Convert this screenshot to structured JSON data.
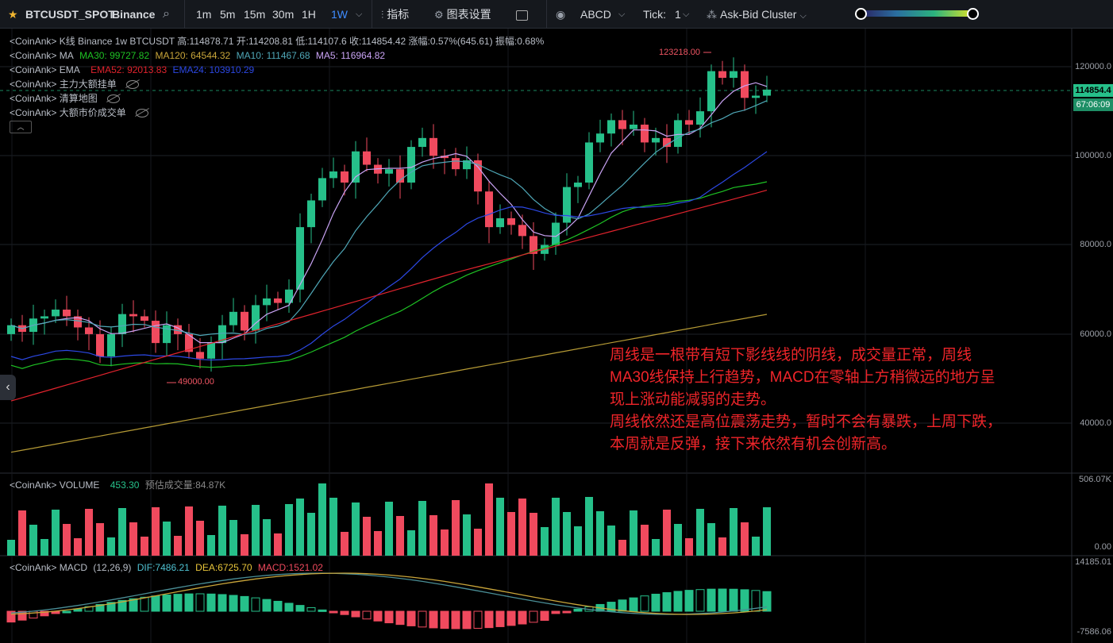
{
  "toolbar": {
    "symbol": "BTCUSDT_SPOT",
    "exchange": "Binance",
    "intervals": [
      "1m",
      "5m",
      "15m",
      "30m",
      "1H",
      "1W"
    ],
    "active_interval": "1W",
    "indicators_label": "指标",
    "chart_settings_label": "图表设置",
    "abcd_label": "ABCD",
    "tick_label": "Tick:",
    "tick_value": "1",
    "cluster_label": "Ask-Bid Cluster"
  },
  "legend": {
    "kline": "<CoinAnk> K线  Binance 1w BTCUSDT 高:114878.71 开:114208.81 低:114107.6 收:114854.42 涨幅:0.57%(645.61) 振幅:0.68%",
    "ma_prefix": "<CoinAnk> MA",
    "ma30": "MA30: 99727.82",
    "ma120": "MA120: 64544.32",
    "ma10": "MA10: 111467.68",
    "ma5": "MA5: 116964.82",
    "ema_prefix": "<CoinAnk> EMA",
    "ema52": "EMA52: 92013.83",
    "ema24": "EMA24: 103910.29",
    "main_orders": "<CoinAnk> 主力大额挂单",
    "liquidation": "<CoinAnk> 清算地图",
    "large_market": "<CoinAnk> 大额市价成交单",
    "volume_prefix": "<CoinAnk> VOLUME",
    "volume_value": "453.30",
    "volume_est": "预估成交量:84.87K",
    "macd_prefix": "<CoinAnk> MACD",
    "macd_params": "(12,26,9)",
    "dif": "DIF:7486.21",
    "dea": "DEA:6725.70",
    "macd": "MACD:1521.02"
  },
  "price_axis": {
    "labels": [
      "120000.0",
      "100000.0",
      "80000.0",
      "60000.0",
      "40000.0"
    ],
    "last_price": "114854.4",
    "countdown": "67:06:09",
    "high_label": "123218.00",
    "low_label": "49000.00"
  },
  "volume_axis": {
    "labels": [
      "506.07K",
      "0.00"
    ]
  },
  "macd_axis": {
    "labels": [
      "14185.01",
      "-7586.06"
    ]
  },
  "annotation": [
    "周线是一根带有短下影线线的阴线，成交量正常，周线",
    "MA30线保持上行趋势，MACD在零轴上方稍微远的地方呈",
    "现上涨动能减弱的走势。",
    "周线依然还是高位震荡走势，暂时不会有暴跌，上周下跌，",
    "本周就是反弹，接下来依然有机会创新高。"
  ],
  "colors": {
    "up": "#26c08a",
    "down": "#f04a5e",
    "ma5": "#c9a3f4",
    "ma10": "#4fa7b7",
    "ma30": "#1ec224",
    "ma120": "#b59a35",
    "ema52": "#e1232d",
    "ema24": "#2c48e4",
    "dif": "#4a8e96",
    "dea": "#c9a53a",
    "annotation": "#f0252a"
  }
}
